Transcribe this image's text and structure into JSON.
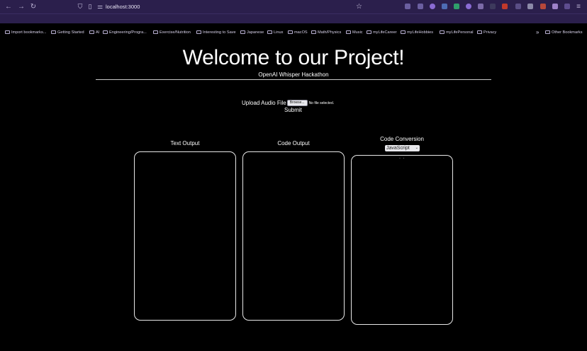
{
  "browser": {
    "url": "localhost:3000",
    "bookmarks": [
      "Import bookmarks...",
      "Getting Started",
      "AI",
      "Engineering/Progra...",
      "Exercise/Nutrition",
      "Interesting to Save",
      "Japanese",
      "Linux",
      "macOS",
      "Math/Physics",
      "Music",
      "myLifeCareer",
      "myLifeHobbies",
      "myLifePersonal",
      "Privacy"
    ],
    "other_bookmarks": "Other Bookmarks",
    "overflow": "»"
  },
  "page": {
    "title": "Welcome to our Project!",
    "subtitle": "OpenAI Whisper Hackathon",
    "upload_label": "Upload Audio File",
    "browse_label": "Browse...",
    "no_file_text": "No file selected.",
    "submit_label": "Submit",
    "text_output_title": "Text Output",
    "code_output_title": "Code Output",
    "code_conversion_title": "Code Conversion",
    "language_selected": "JavaScript",
    "conversion_placeholder": "· ·"
  }
}
